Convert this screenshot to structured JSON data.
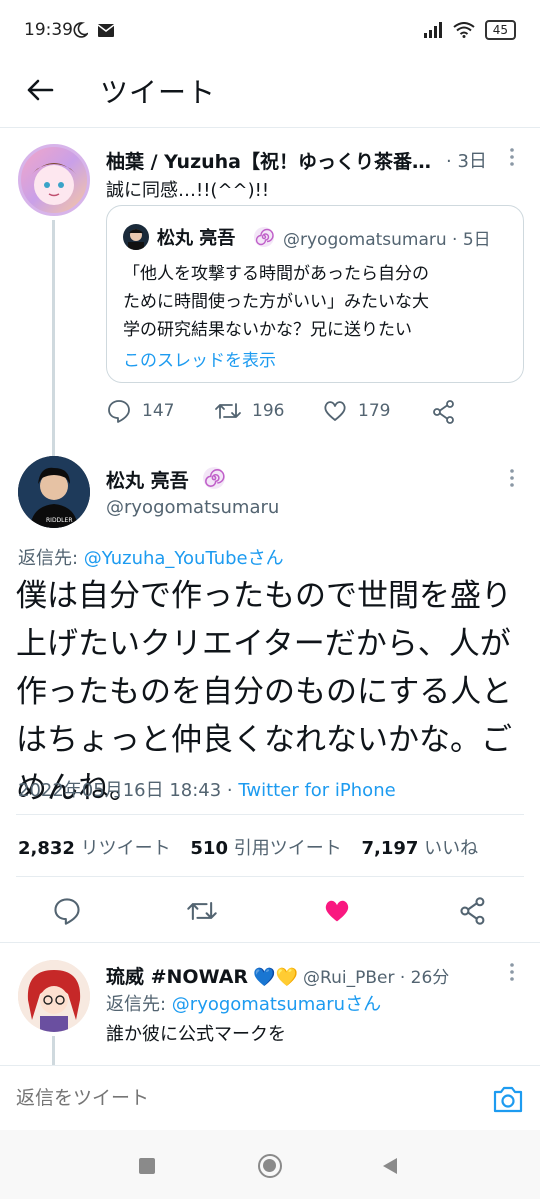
{
  "status_bar": {
    "time": "19:39",
    "battery": "45"
  },
  "header": {
    "title": "ツイート"
  },
  "parent_tweet": {
    "display_name": "柚葉 / Yuzuha【祝！ゆっくり茶番…",
    "time": "· 3日",
    "text": "誠に同感…!!(^^)!!",
    "quote": {
      "display_name": "松丸 亮吾",
      "handle_time": "@ryogomatsumaru · 5日",
      "lines": [
        "「他人を攻撃する時間があったら自分の",
        "ために時間使った方がいい」みたいな大",
        "学の研究結果ないかな？兄に送りたい"
      ],
      "show_thread": "このスレッドを表示"
    },
    "stats": {
      "replies": "147",
      "retweets": "196",
      "likes": "179"
    }
  },
  "main_tweet": {
    "display_name": "松丸 亮吾",
    "handle": "@ryogomatsumaru",
    "reply_prefix": "返信先: ",
    "reply_to": "@Yuzuha_YouTubeさん",
    "lines": [
      "僕は自分で作ったもので世間を盛り",
      "上げたいクリエイターだから、人が",
      "作ったものを自分のものにする人と",
      "はちょっと仲良くなれないかな。ご",
      "めんね。"
    ],
    "timestamp": "2022年05月16日 18:43 · ",
    "source": "Twitter for iPhone",
    "counts": {
      "retweets_num": "2,832",
      "retweets_label": "リツイート",
      "quotes_num": "510",
      "quotes_label": "引用ツイート",
      "likes_num": "7,197",
      "likes_label": "いいね"
    }
  },
  "reply_tweet": {
    "display_name": "琉威 #NOWAR",
    "hearts": "💙💛",
    "handle_time": "@Rui_PBer · 26分",
    "reply_prefix": "返信先: ",
    "reply_to": "@ryogomatsumaruさん",
    "text": "誰か彼に公式マークを"
  },
  "reply_bar": {
    "placeholder": "返信をツイート"
  },
  "colors": {
    "accent": "#1d9bf0",
    "like": "#f91880",
    "text": "#0f1419",
    "secondary": "#536471"
  }
}
